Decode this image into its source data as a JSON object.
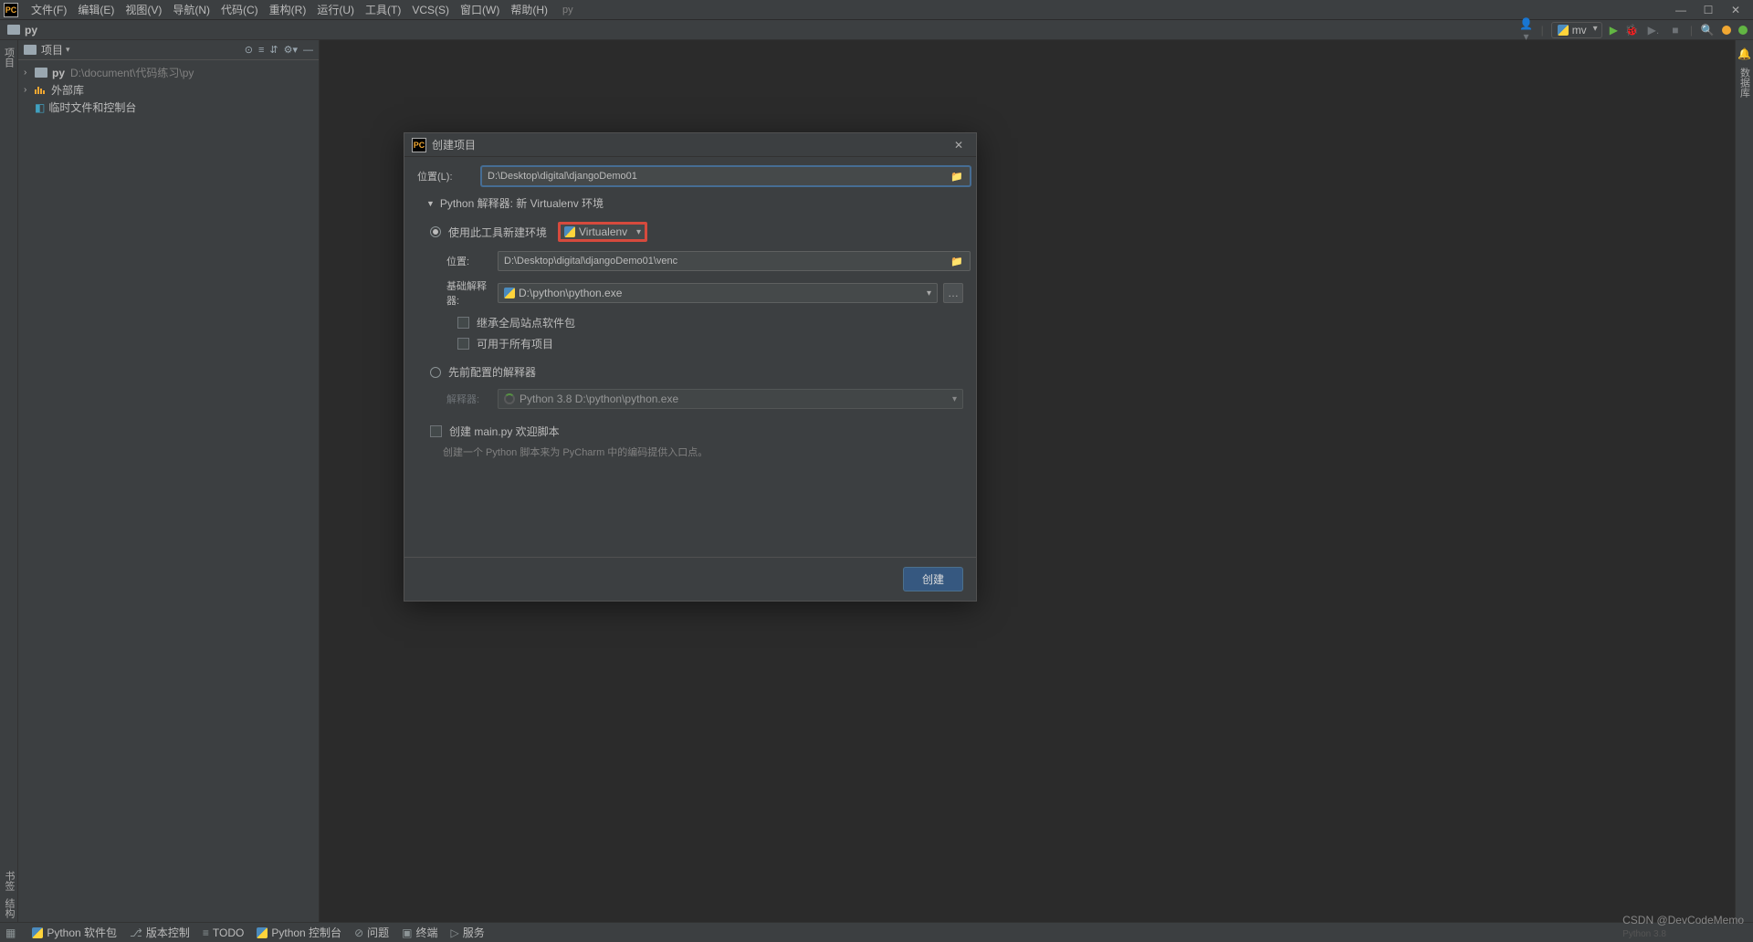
{
  "menubar": {
    "items": [
      "文件(F)",
      "编辑(E)",
      "视图(V)",
      "导航(N)",
      "代码(C)",
      "重构(R)",
      "运行(U)",
      "工具(T)",
      "VCS(S)",
      "窗口(W)",
      "帮助(H)"
    ],
    "project_suffix": "py"
  },
  "breadcrumb": {
    "folder": "py"
  },
  "toolbar_right": {
    "config": "mv"
  },
  "sidebar": {
    "header": "项目",
    "tree": {
      "root_name": "py",
      "root_path": "D:\\document\\代码练习\\py",
      "ext_libs": "外部库",
      "scratches": "临时文件和控制台"
    }
  },
  "left_tabs": {
    "project": "项目"
  },
  "bottom_left_tabs": {
    "bookmarks": "书签",
    "structure": "结构"
  },
  "right_tabs": {
    "notifications": "通知",
    "db": "数据库"
  },
  "dialog": {
    "title": "创建项目",
    "location_label": "位置(L):",
    "location_value": "D:\\Desktop\\digital\\djangoDemo01",
    "interpreter_section": "Python 解释器: 新 Virtualenv 环境",
    "radio_new": "使用此工具新建环境",
    "tool_value": "Virtualenv",
    "venv_location_label": "位置:",
    "venv_location_value": "D:\\Desktop\\digital\\djangoDemo01\\venc",
    "base_interp_label": "基础解释器:",
    "base_interp_value": "D:\\python\\python.exe",
    "inherit_label": "继承全局站点软件包",
    "all_projects_label": "可用于所有项目",
    "radio_existing": "先前配置的解释器",
    "existing_interp_label": "解释器:",
    "existing_interp_value": "Python 3.8 D:\\python\\python.exe",
    "create_main_label": "创建 main.py 欢迎脚本",
    "create_main_hint": "创建一个 Python 脚本来为 PyCharm 中的编码提供入口点。",
    "create_btn": "创建"
  },
  "statusbar": {
    "packages": "Python 软件包",
    "vcs": "版本控制",
    "todo": "TODO",
    "console": "Python 控制台",
    "problems": "问题",
    "terminal": "终端",
    "services": "服务"
  },
  "watermark": "CSDN @DevCodeMemo",
  "watermark2": "Python 3.8"
}
